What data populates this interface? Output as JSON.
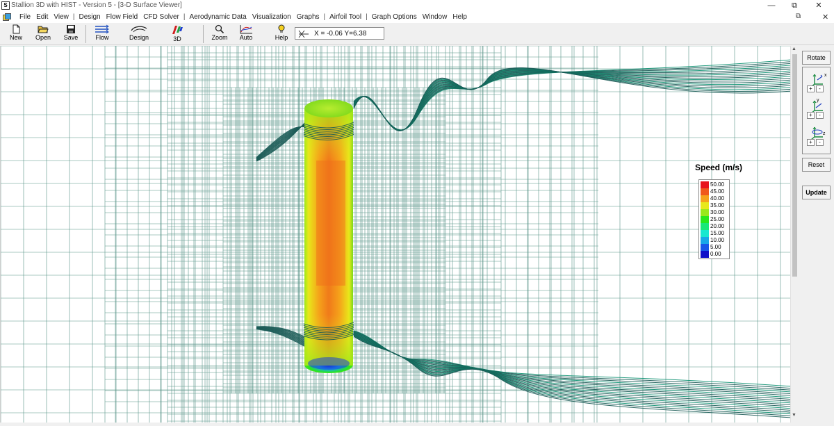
{
  "window": {
    "title": "Stallion 3D with HIST - Version 5 - [3-D Surface Viewer]",
    "logo_text": "S",
    "controls": {
      "minimize": "—",
      "restore": "⧉",
      "close": "✕"
    },
    "mdi_controls": {
      "restore": "⧉",
      "close": "✕"
    }
  },
  "menu": {
    "items": [
      "File",
      "Edit",
      "View",
      "|",
      "Design",
      "Flow Field",
      "CFD Solver",
      "|",
      "Aerodynamic Data",
      "Visualization",
      "Graphs",
      "|",
      "Airfoil Tool",
      "|",
      "Graph Options",
      "Window",
      "Help"
    ]
  },
  "toolbar": {
    "new": "New",
    "open": "Open",
    "save": "Save",
    "flow": "Flow",
    "design": "Design",
    "view3d": "3D",
    "zoom": "Zoom",
    "auto": "Auto",
    "help": "Help",
    "coords": "X = -0.06  Y=6.38"
  },
  "legend": {
    "title": "Speed (m/s)",
    "entries": [
      {
        "label": "50.00",
        "color": "#e8141c"
      },
      {
        "label": "45.00",
        "color": "#f0581a"
      },
      {
        "label": "40.00",
        "color": "#f5a21a"
      },
      {
        "label": "35.00",
        "color": "#e8e81a"
      },
      {
        "label": "30.00",
        "color": "#9ae81a"
      },
      {
        "label": "25.00",
        "color": "#2ae81a"
      },
      {
        "label": "20.00",
        "color": "#18e878"
      },
      {
        "label": "15.00",
        "color": "#18e8d0"
      },
      {
        "label": "10.00",
        "color": "#18a8e8"
      },
      {
        "label": "5.00",
        "color": "#1858e8"
      },
      {
        "label": "0.00",
        "color": "#1010c8"
      }
    ]
  },
  "right_panel": {
    "rotate": "Rotate",
    "reset": "Reset",
    "update": "Update",
    "axes": [
      "x",
      "y",
      "z"
    ],
    "plus": "+",
    "minus": "-"
  },
  "scrollbar": {
    "up": "▲",
    "down": "▼"
  },
  "colors": {
    "grid": "#1f6f5e",
    "streamline": "#1a5a55",
    "streamline_bright": "#0a8f6f"
  }
}
